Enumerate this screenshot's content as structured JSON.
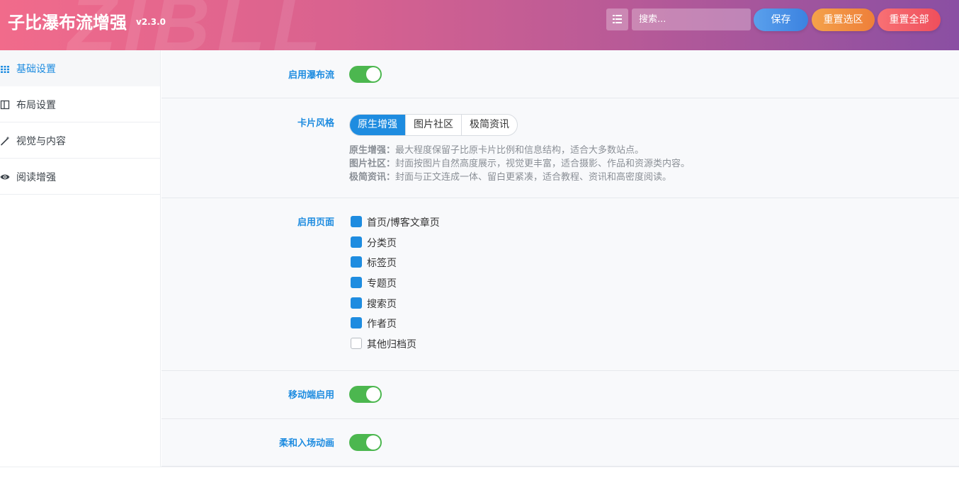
{
  "header": {
    "watermark": "ZIBLL",
    "title": "子比瀑布流增强",
    "version": "v2.3.0",
    "search_placeholder": "搜索...",
    "save_label": "保存",
    "reset_selection_label": "重置选区",
    "reset_all_label": "重置全部"
  },
  "sidebar": {
    "items": [
      {
        "label": "基础设置",
        "icon": "grid-icon",
        "active": true
      },
      {
        "label": "布局设置",
        "icon": "columns-icon",
        "active": false
      },
      {
        "label": "视觉与内容",
        "icon": "wand-icon",
        "active": false
      },
      {
        "label": "阅读增强",
        "icon": "eye-icon",
        "active": false
      }
    ]
  },
  "settings": {
    "enable_waterfall": {
      "label": "启用瀑布流",
      "on": true
    },
    "card_style": {
      "label": "卡片风格",
      "options": [
        "原生增强",
        "图片社区",
        "极简资讯"
      ],
      "selected": "原生增强",
      "descriptions": [
        {
          "name": "原生增强：",
          "text": "最大程度保留子比原卡片比例和信息结构，适合大多数站点。"
        },
        {
          "name": "图片社区：",
          "text": "封面按图片自然高度展示，视觉更丰富，适合摄影、作品和资源类内容。"
        },
        {
          "name": "极简资讯：",
          "text": "封面与正文连成一体、留白更紧凑，适合教程、资讯和高密度阅读。"
        }
      ]
    },
    "enabled_pages": {
      "label": "启用页面",
      "items": [
        {
          "label": "首页/博客文章页",
          "checked": true
        },
        {
          "label": "分类页",
          "checked": true
        },
        {
          "label": "标签页",
          "checked": true
        },
        {
          "label": "专题页",
          "checked": true
        },
        {
          "label": "搜索页",
          "checked": true
        },
        {
          "label": "作者页",
          "checked": true
        },
        {
          "label": "其他归档页",
          "checked": false
        }
      ]
    },
    "mobile_enable": {
      "label": "移动端启用",
      "on": true
    },
    "soft_entrance": {
      "label": "柔和入场动画",
      "on": true
    }
  },
  "colors": {
    "accent": "#1e8ce0",
    "toggle_on": "#4cb74f",
    "save": "#4a93e6",
    "reset_selection": "#f08f42",
    "reset_all": "#f3606a"
  }
}
